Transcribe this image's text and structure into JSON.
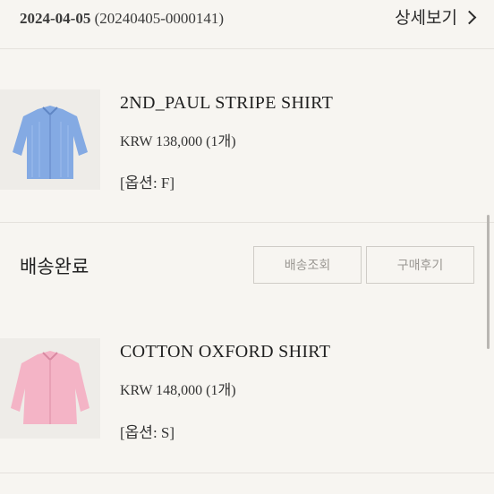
{
  "order": {
    "date": "2024-04-05",
    "number": "(20240405-0000141)",
    "detail_label": "상세보기"
  },
  "products": [
    {
      "name": "2ND_PAUL STRIPE SHIRT",
      "price": "KRW 138,000 (1개)",
      "option": "[옵션: F]",
      "image_color": "#7fa6e0",
      "image_icon": "blue-shirt-image"
    },
    {
      "name": "COTTON OXFORD SHIRT",
      "price": "KRW 148,000 (1개)",
      "option": "[옵션: S]",
      "image_color": "#f2b3c4",
      "image_icon": "pink-shirt-image"
    }
  ],
  "shipment": {
    "status": "배송완료",
    "track_label": "배송조회",
    "review_label": "구매후기"
  },
  "colors": {
    "background": "#f7f5f1",
    "text": "#2b2b2b",
    "button_border": "#cfccc7",
    "button_text": "#9a9792"
  }
}
